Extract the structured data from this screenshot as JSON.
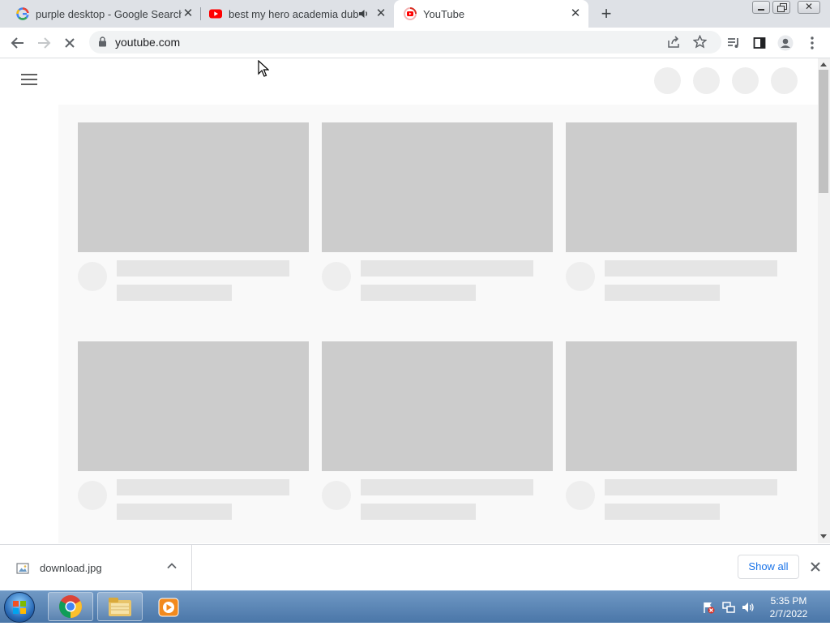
{
  "tabs": [
    {
      "title": "purple desktop - Google Search",
      "favicon": "google-g-icon",
      "active": false
    },
    {
      "title": "best my hero academia dub",
      "favicon": "youtube-icon",
      "active": false,
      "audio": "speaker-icon"
    },
    {
      "title": "YouTube",
      "favicon": "youtube-loading-icon",
      "active": true
    }
  ],
  "toolbar": {
    "url": "youtube.com"
  },
  "download": {
    "filename": "download.jpg",
    "show_all_label": "Show all"
  },
  "clock": {
    "time": "5:35 PM",
    "date": "2/7/2022"
  },
  "colors": {
    "tab_strip": "#dee1e6",
    "skeleton_thumb": "#cccccc",
    "skeleton_text": "#e5e5e5",
    "accent": "#1a73e8"
  }
}
